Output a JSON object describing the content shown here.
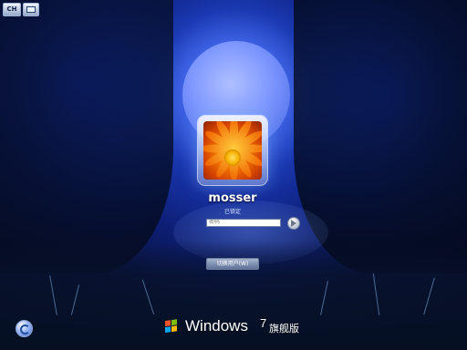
{
  "top_bar": {
    "language_button": "CH",
    "keyboard_icon": "keyboard-icon"
  },
  "login": {
    "username": "mosser",
    "status": "已锁定",
    "password_placeholder": "密码",
    "submit_icon": "arrow-right-icon",
    "switch_user_label": "切换用户(W)"
  },
  "footer": {
    "accessibility_icon": "ease-of-access-icon",
    "brand": "Windows",
    "version": "7",
    "edition": "旗舰版"
  },
  "colors": {
    "background_main": "#0d1f78",
    "moon": "#7f98ff",
    "avatar_orange": "#f06d00"
  }
}
